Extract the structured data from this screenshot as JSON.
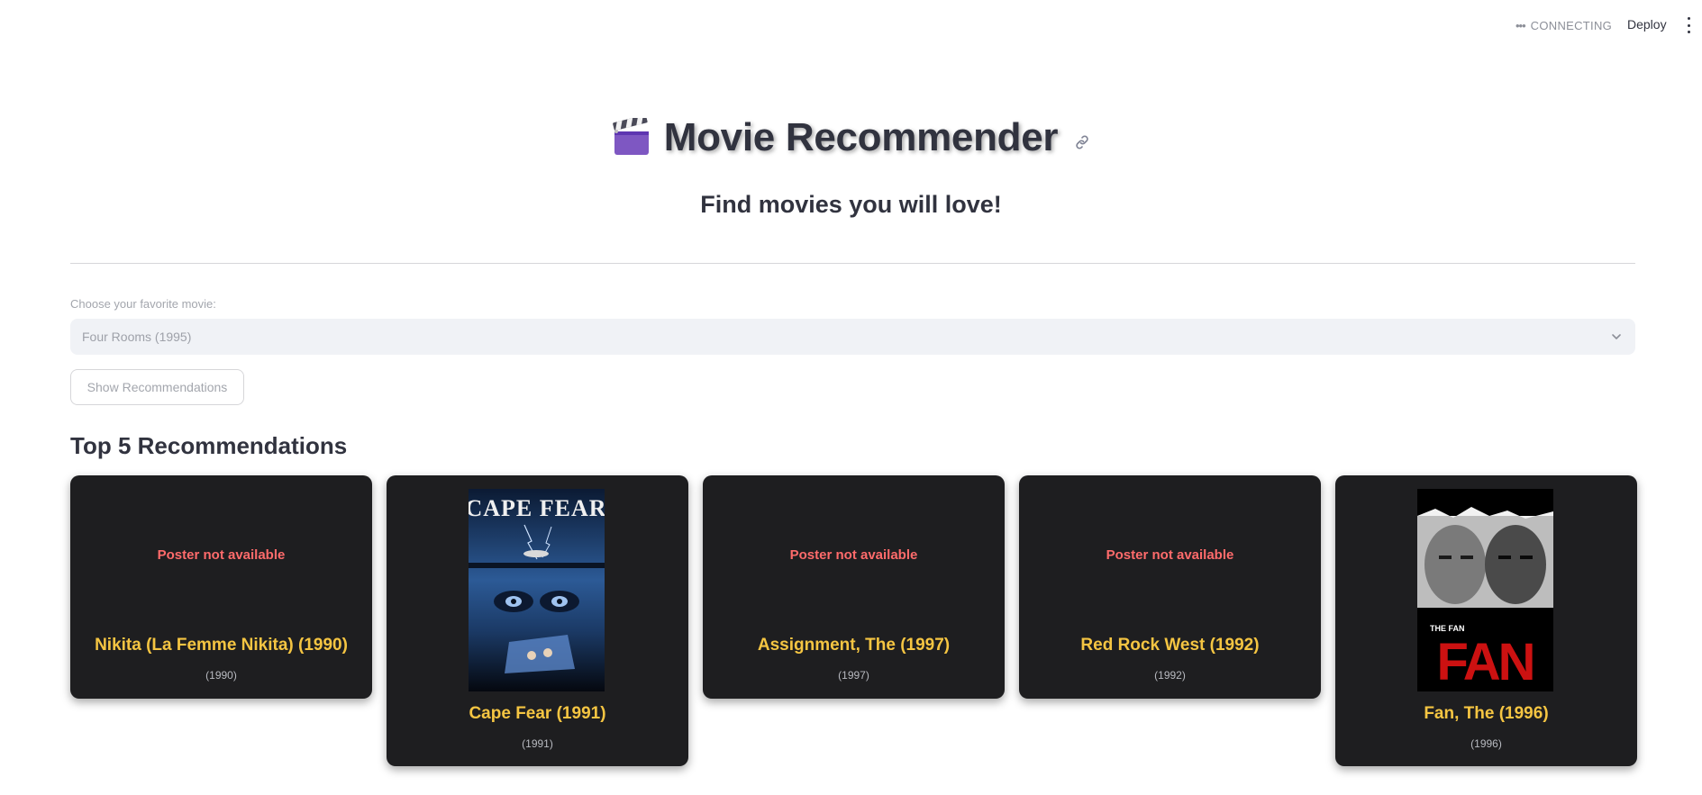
{
  "topbar": {
    "status": "CONNECTING",
    "deploy_label": "Deploy"
  },
  "header": {
    "icon": "clapper-board-icon",
    "title": "Movie Recommender",
    "subtitle": "Find movies you will love!"
  },
  "select": {
    "label": "Choose your favorite movie:",
    "value": "Four Rooms (1995)"
  },
  "button_label": "Show Recommendations",
  "section_title": "Top 5 Recommendations",
  "recommendations": [
    {
      "title": "Nikita (La Femme Nikita) (1990)",
      "year": "(1990)",
      "poster_text": "Poster not available"
    },
    {
      "title": "Cape Fear (1991)",
      "year": "(1991)",
      "poster_text": "CAPE FEAR"
    },
    {
      "title": "Assignment, The (1997)",
      "year": "(1997)",
      "poster_text": "Poster not available"
    },
    {
      "title": "Red Rock West (1992)",
      "year": "(1992)",
      "poster_text": "Poster not available"
    },
    {
      "title": "Fan, The (1996)",
      "year": "(1996)",
      "poster_text": "THE FAN"
    }
  ],
  "colors": {
    "card_bg": "#1e1e20",
    "card_title": "#f5c542",
    "missing_poster": "#ff6b6b",
    "fan_red": "#cc1111"
  }
}
